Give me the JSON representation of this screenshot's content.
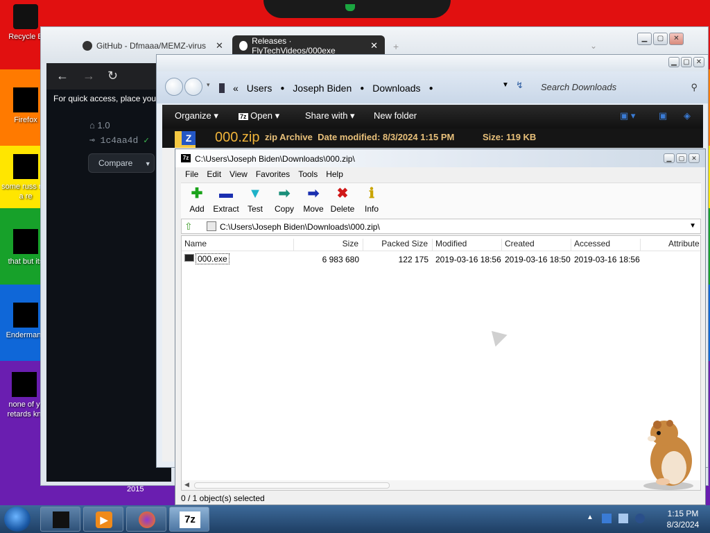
{
  "desktop": {
    "icons": [
      {
        "label": "Recycle B"
      },
      {
        "label": "Firefox"
      },
      {
        "label": "some russ ran a re"
      },
      {
        "label": "that but its"
      },
      {
        "label": "Endermann"
      },
      {
        "label": "none of y retards kn"
      }
    ]
  },
  "browser": {
    "tabs": [
      {
        "label": "GitHub - Dfmaaa/MEMZ-virus"
      },
      {
        "label": "Releases · FlyTechVideos/000exe"
      }
    ],
    "quick_access_text": "For quick access, place your",
    "release": {
      "tag": "1.0",
      "commit": "1c4aa4d",
      "compare_label": "Compare"
    },
    "year_label": "2015"
  },
  "explorer": {
    "breadcrumb": [
      "Users",
      "Joseph Biden",
      "Downloads"
    ],
    "search_placeholder": "Search Downloads",
    "toolbar": {
      "organize": "Organize",
      "open": "Open",
      "share_with": "Share with",
      "new_folder": "New folder"
    },
    "selected_file": {
      "name": "000.zip",
      "type": "zip Archive",
      "date_modified": "Date modified: 8/3/2024 1:15 PM",
      "size": "Size: 119 KB"
    }
  },
  "sevenzip": {
    "title": "C:\\Users\\Joseph Biden\\Downloads\\000.zip\\",
    "menu": [
      "File",
      "Edit",
      "View",
      "Favorites",
      "Tools",
      "Help"
    ],
    "tools": [
      {
        "label": "Add",
        "icon": "add-icon",
        "glyph": "✚",
        "color": "#1aa31a"
      },
      {
        "label": "Extract",
        "icon": "extract-icon",
        "glyph": "▬",
        "color": "#1a2fb0"
      },
      {
        "label": "Test",
        "icon": "test-icon",
        "glyph": "▼",
        "color": "#1fb2c8"
      },
      {
        "label": "Copy",
        "icon": "copy-icon",
        "glyph": "➡",
        "color": "#1a8f7a"
      },
      {
        "label": "Move",
        "icon": "move-icon",
        "glyph": "➡",
        "color": "#1a2fb0"
      },
      {
        "label": "Delete",
        "icon": "delete-icon",
        "glyph": "✖",
        "color": "#d01818"
      },
      {
        "label": "Info",
        "icon": "info-icon",
        "glyph": "ℹ",
        "color": "#c9a400"
      }
    ],
    "path": "C:\\Users\\Joseph Biden\\Downloads\\000.zip\\",
    "columns": [
      "Name",
      "Size",
      "Packed Size",
      "Modified",
      "Created",
      "Accessed",
      "Attribute"
    ],
    "files": [
      {
        "name": "000.exe",
        "size": "6 983 680",
        "packed": "122 175",
        "modified": "2019-03-16 18:56",
        "created": "2019-03-16 18:50",
        "accessed": "2019-03-16 18:56"
      }
    ],
    "status": "0 / 1 object(s) selected"
  },
  "taskbar": {
    "time": "1:15 PM",
    "date": "8/3/2024",
    "seven_zip_label": "7z"
  }
}
